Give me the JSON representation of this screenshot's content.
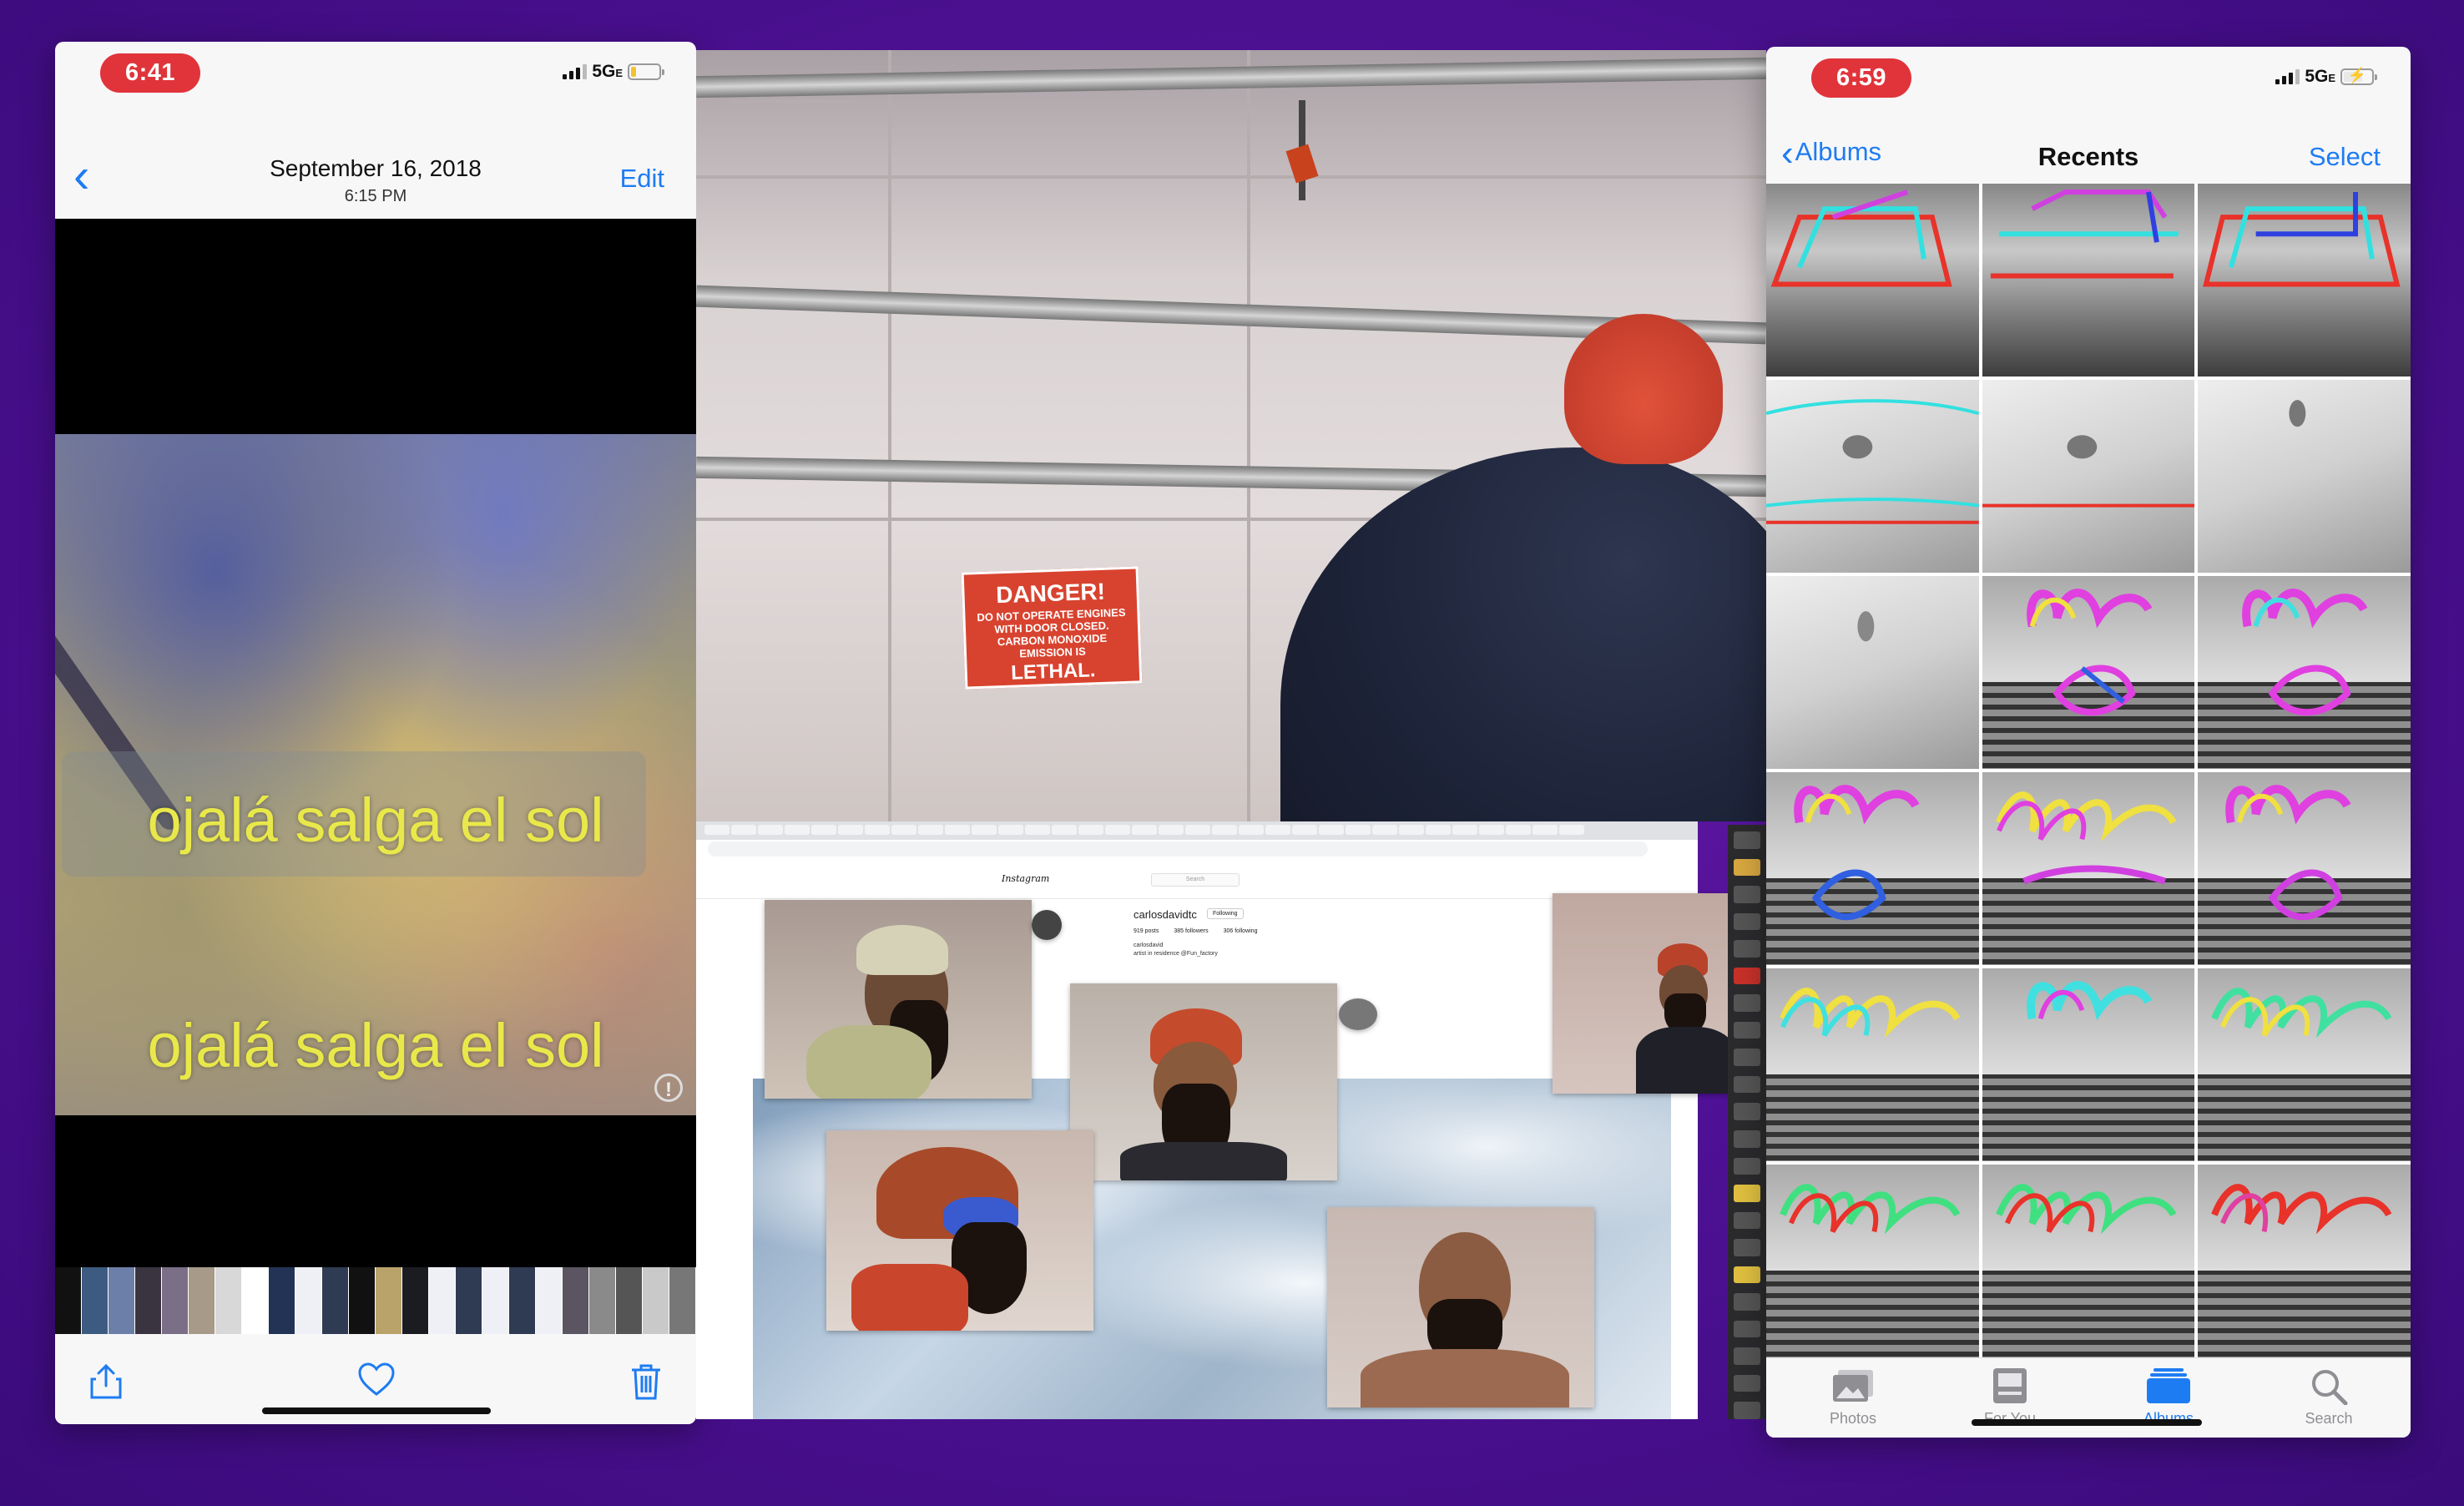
{
  "left_phone": {
    "status": {
      "time": "6:41",
      "network": "5G",
      "network_suffix": "E"
    },
    "nav": {
      "title": "September 16, 2018",
      "subtitle": "6:15 PM",
      "edit_label": "Edit"
    },
    "video": {
      "subtitle_line_1": "ojalá salga el sol",
      "subtitle_line_2": "ojalá salga el sol"
    },
    "toolbar": {
      "share_icon": "share-icon",
      "favorite_icon": "heart-icon",
      "delete_icon": "trash-icon"
    }
  },
  "middle": {
    "danger_sign": {
      "title": "DANGER!",
      "body": "DO NOT OPERATE ENGINES WITH DOOR CLOSED. CARBON MONOXIDE EMISSION IS",
      "lethal": "LETHAL."
    },
    "instagram": {
      "logo": "Instagram",
      "search_placeholder": "Search",
      "username": "carlosdavidtc",
      "follow_label": "Following",
      "posts": "919 posts",
      "followers": "385 followers",
      "following": "306 following",
      "bio_name": "carlosdavid",
      "bio_text": "artist in residence @Fun_factory"
    }
  },
  "right_phone": {
    "status": {
      "time": "6:59",
      "network": "5G",
      "network_suffix": "E"
    },
    "nav": {
      "back_label": "Albums",
      "title": "Recents",
      "select_label": "Select"
    },
    "tabs": [
      {
        "label": "Photos",
        "icon": "photos-icon",
        "active": false
      },
      {
        "label": "For You",
        "icon": "for-you-icon",
        "active": false
      },
      {
        "label": "Albums",
        "icon": "albums-icon",
        "active": true
      },
      {
        "label": "Search",
        "icon": "search-icon",
        "active": false
      }
    ],
    "colors": {
      "accent": "#1e7cf2",
      "inactive": "#8e8e93"
    }
  },
  "colors": {
    "time_pill": "#e0343a",
    "subtitle_text": "#e9e84a",
    "background": "#4f1196"
  }
}
